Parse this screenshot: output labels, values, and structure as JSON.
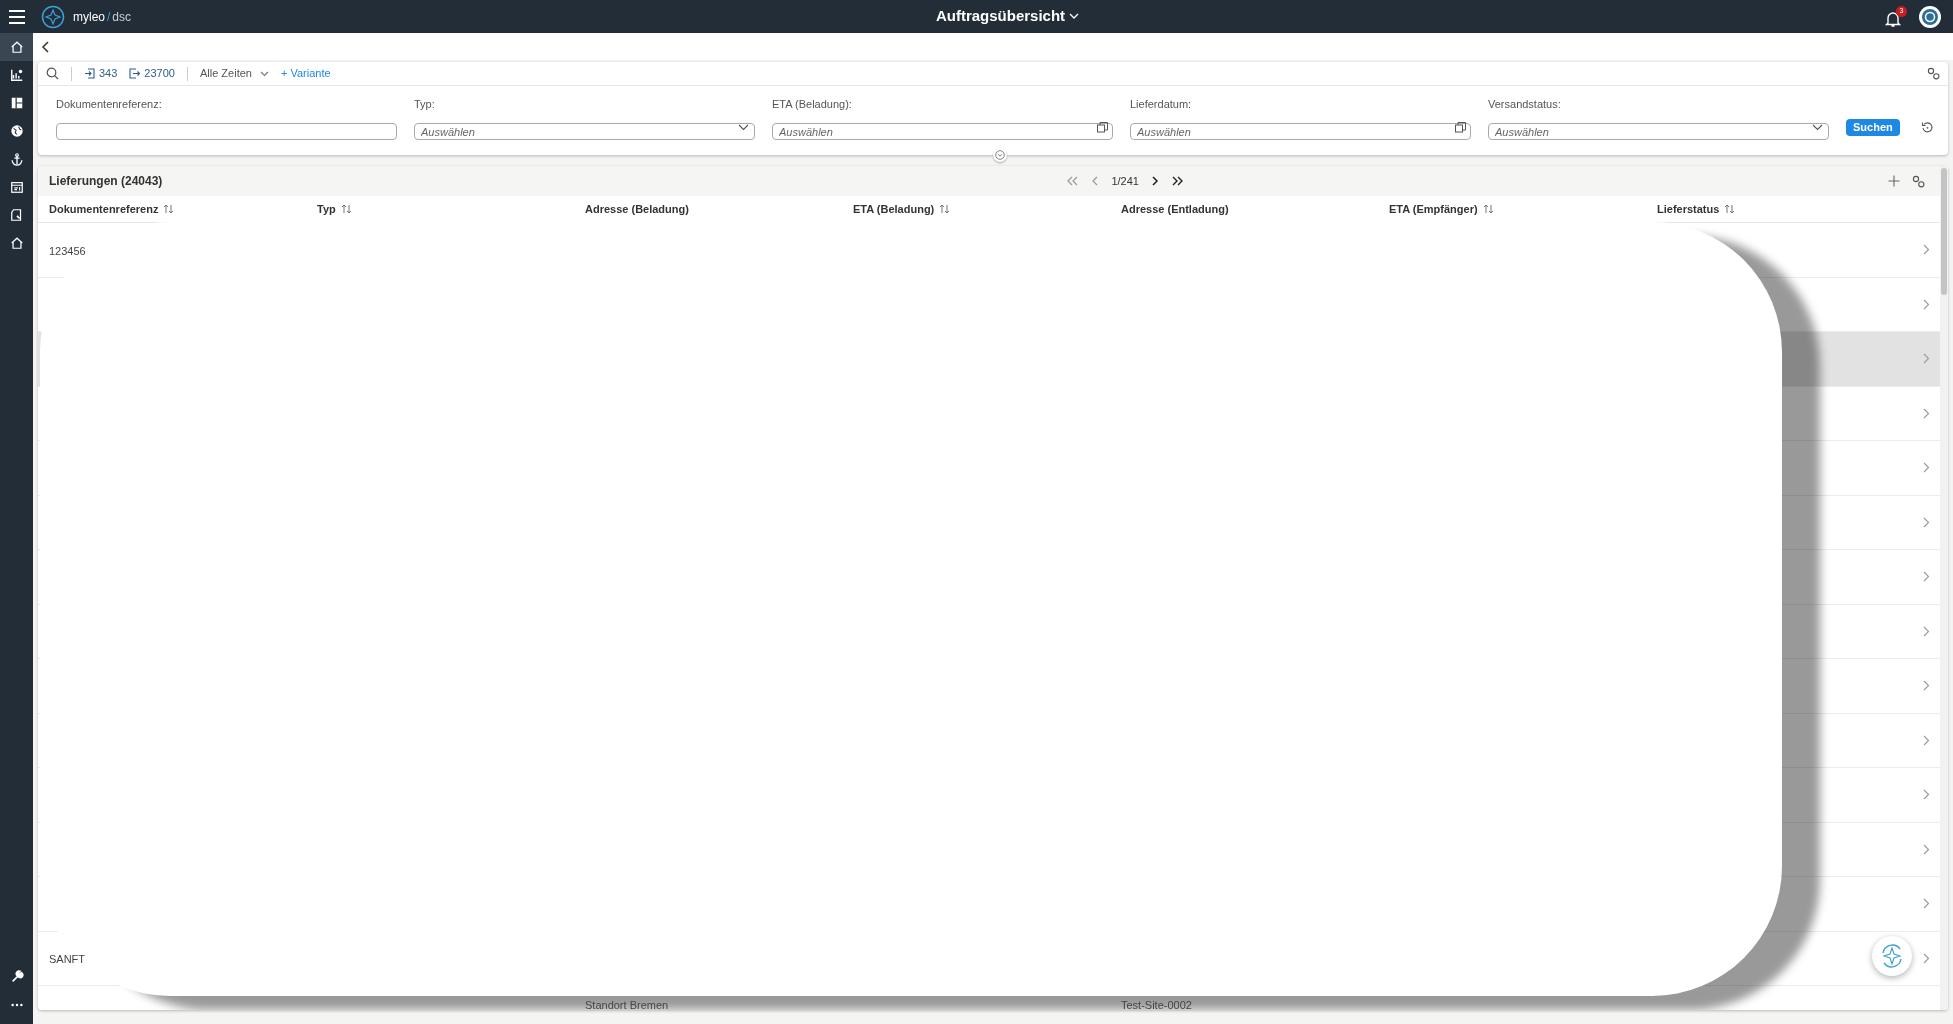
{
  "top_bar": {
    "brand": "myleo",
    "brand_separator": "/",
    "brand_product": "dsc",
    "title": "Auftragsübersicht",
    "notification_count": "3"
  },
  "sidebar": {
    "items": [
      {
        "selected": true
      },
      {
        "selected": false
      },
      {
        "selected": false
      },
      {
        "selected": false
      },
      {
        "selected": false
      },
      {
        "selected": false
      },
      {
        "selected": false
      },
      {
        "selected": false
      }
    ]
  },
  "filter_bar": {
    "incoming_count": "343",
    "outgoing_count": "23700",
    "time_range": "Alle Zeiten",
    "add_variant": "+ Variante",
    "fields": [
      {
        "kind": "text",
        "label": "Dokumentenreferenz:"
      },
      {
        "kind": "select",
        "label": "Typ:",
        "placeholder": "Auswählen"
      },
      {
        "kind": "date",
        "label": "ETA (Beladung):",
        "placeholder": "Auswählen"
      },
      {
        "kind": "date",
        "label": "Lieferdatum:",
        "placeholder": "Auswählen"
      },
      {
        "kind": "select",
        "label": "Versandstatus:",
        "placeholder": "Auswählen"
      }
    ],
    "search_button": "Suchen"
  },
  "table": {
    "title": "Lieferungen (24043)",
    "page": "1/241",
    "first_disabled": true,
    "prev_disabled": true,
    "columns": [
      {
        "label": "Dokumentenreferenz",
        "sortable": true
      },
      {
        "label": "Typ",
        "sortable": true
      },
      {
        "label": "Adresse (Beladung)",
        "sortable": false
      },
      {
        "label": "ETA (Beladung)",
        "sortable": true
      },
      {
        "label": "Adresse (Entladung)",
        "sortable": false
      },
      {
        "label": "ETA (Empfänger)",
        "sortable": true
      },
      {
        "label": "Lieferstatus",
        "sortable": true
      }
    ],
    "rows": [
      {
        "selected": false,
        "document_reference": "123456"
      },
      {
        "selected": false
      },
      {
        "selected": true
      },
      {
        "selected": false
      },
      {
        "selected": false
      },
      {
        "selected": false
      },
      {
        "selected": false
      },
      {
        "selected": false
      },
      {
        "selected": false
      },
      {
        "selected": false
      },
      {
        "selected": false
      },
      {
        "selected": false
      },
      {
        "selected": false
      },
      {
        "selected": false,
        "document_reference": "SANFT"
      },
      {
        "selected": false,
        "loading_address": "Standort Bremen",
        "unloading_address": "Test-Site-0002"
      }
    ]
  }
}
